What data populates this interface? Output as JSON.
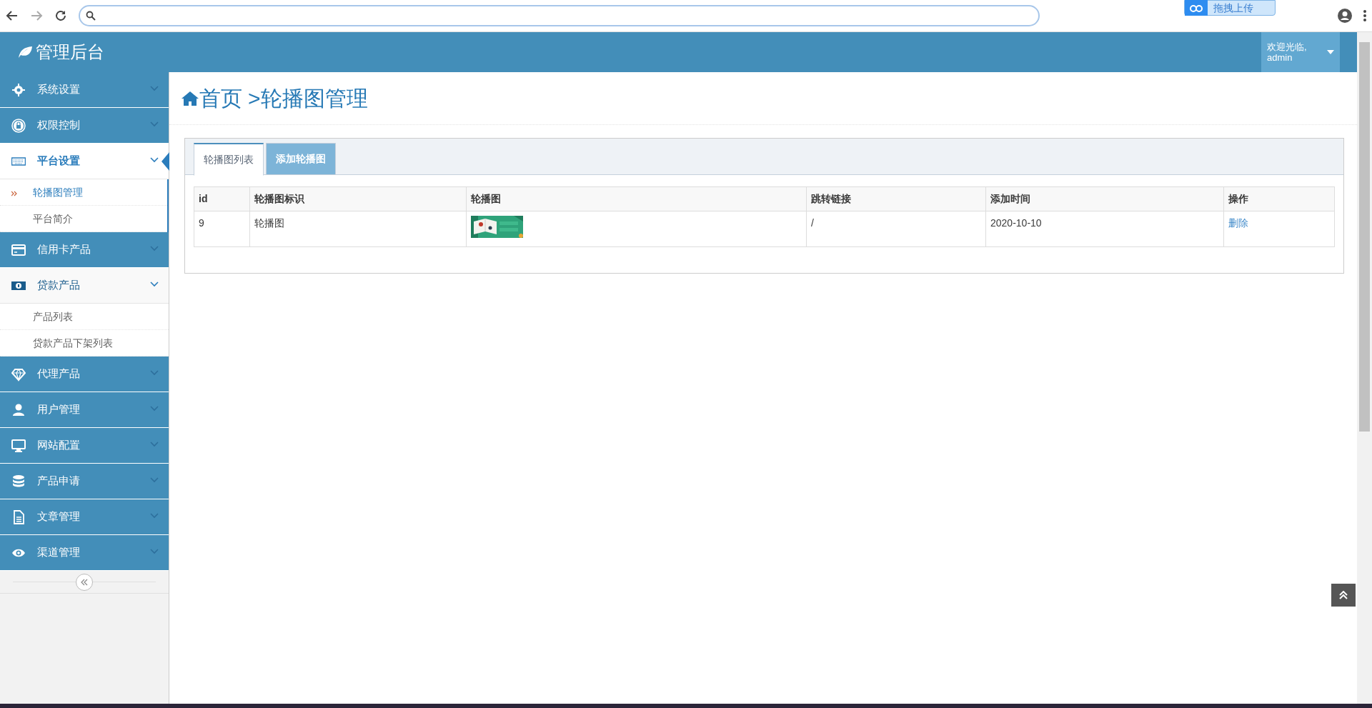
{
  "browser": {
    "extension_button": "拖拽上传"
  },
  "header": {
    "logo": "管理后台",
    "greeting": "欢迎光临,",
    "user": "admin"
  },
  "sidebar": {
    "items": [
      {
        "label": "系统设置",
        "selected": false,
        "expanded": false
      },
      {
        "label": "权限控制",
        "selected": false,
        "expanded": false
      },
      {
        "label": "平台设置",
        "selected": true,
        "expanded": true,
        "children": [
          {
            "label": "轮播图管理",
            "selected": true
          },
          {
            "label": "平台简介",
            "selected": false
          }
        ]
      },
      {
        "label": "信用卡产品",
        "selected": false,
        "expanded": false
      },
      {
        "label": "贷款产品",
        "selected": false,
        "expanded": true,
        "children": [
          {
            "label": "产品列表",
            "selected": false
          },
          {
            "label": "贷款产品下架列表",
            "selected": false
          }
        ]
      },
      {
        "label": "代理产品",
        "selected": false,
        "expanded": false
      },
      {
        "label": "用户管理",
        "selected": false,
        "expanded": false
      },
      {
        "label": "网站配置",
        "selected": false,
        "expanded": false
      },
      {
        "label": "产品申请",
        "selected": false,
        "expanded": false
      },
      {
        "label": "文章管理",
        "selected": false,
        "expanded": false
      },
      {
        "label": "渠道管理",
        "selected": false,
        "expanded": false
      }
    ]
  },
  "breadcrumb": {
    "home": "首页",
    "current": ">轮播图管理"
  },
  "tabs": [
    {
      "label": "轮播图列表",
      "selected": true
    },
    {
      "label": "添加轮播图",
      "selected": false
    }
  ],
  "table": {
    "columns": [
      "id",
      "轮播图标识",
      "轮播图",
      "跳转链接",
      "添加时间",
      "操作"
    ],
    "rows": [
      {
        "id": "9",
        "name": "轮播图",
        "link": "/",
        "time": "2020-10-10",
        "action": "删除"
      }
    ]
  }
}
